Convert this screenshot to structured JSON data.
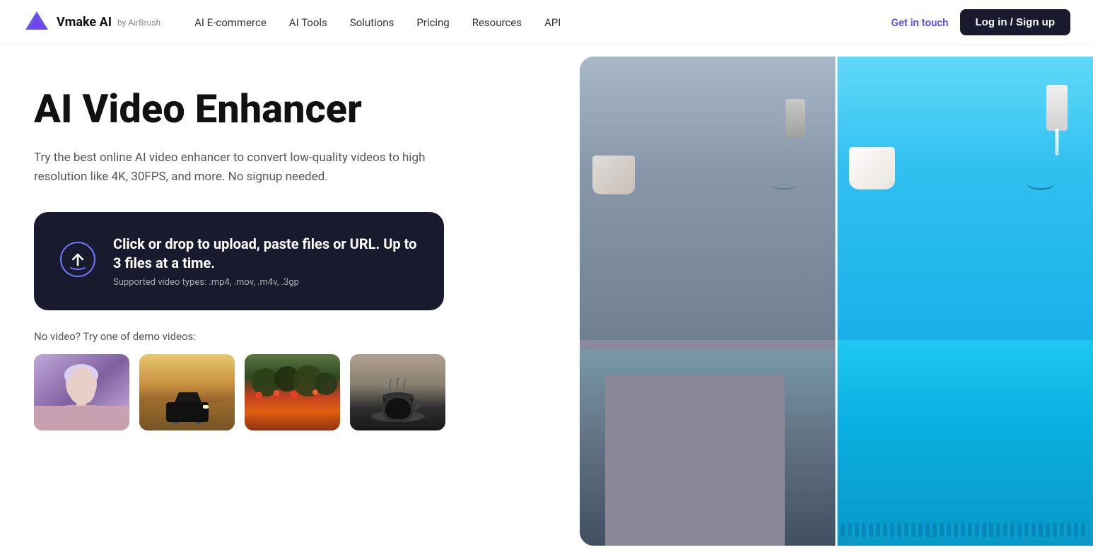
{
  "brand": {
    "logo_text": "Vmake AI",
    "logo_by": "by AirBrush"
  },
  "nav": {
    "links": [
      {
        "id": "ai-ecommerce",
        "label": "AI E-commerce"
      },
      {
        "id": "ai-tools",
        "label": "AI Tools"
      },
      {
        "id": "solutions",
        "label": "Solutions"
      },
      {
        "id": "pricing",
        "label": "Pricing"
      },
      {
        "id": "resources",
        "label": "Resources"
      },
      {
        "id": "api",
        "label": "API"
      }
    ],
    "get_in_touch": "Get in touch",
    "login_label": "Log in / Sign up"
  },
  "hero": {
    "title": "AI Video Enhancer",
    "description": "Try the best online AI video enhancer to convert low-quality videos to high resolution like 4K, 30FPS, and more. No signup needed."
  },
  "upload": {
    "main_text": "Click or drop to upload, paste files or URL. Up to 3 files at a time.",
    "sub_text": "Supported video types: .mp4, .mov, .m4v, .3gp"
  },
  "demo": {
    "label": "No video? Try one of demo videos:",
    "thumbnails": [
      {
        "id": "thumb-person",
        "alt": "Person demo video"
      },
      {
        "id": "thumb-car",
        "alt": "Car on dunes demo video"
      },
      {
        "id": "thumb-landscape",
        "alt": "Landscape demo video"
      },
      {
        "id": "thumb-coffee",
        "alt": "Coffee cup demo video"
      }
    ]
  },
  "comparison": {
    "alt": "Before and after AI video enhancement showing a coffee machine"
  },
  "colors": {
    "accent": "#5b4cf5",
    "dark": "#1a1a2e",
    "white": "#ffffff"
  }
}
